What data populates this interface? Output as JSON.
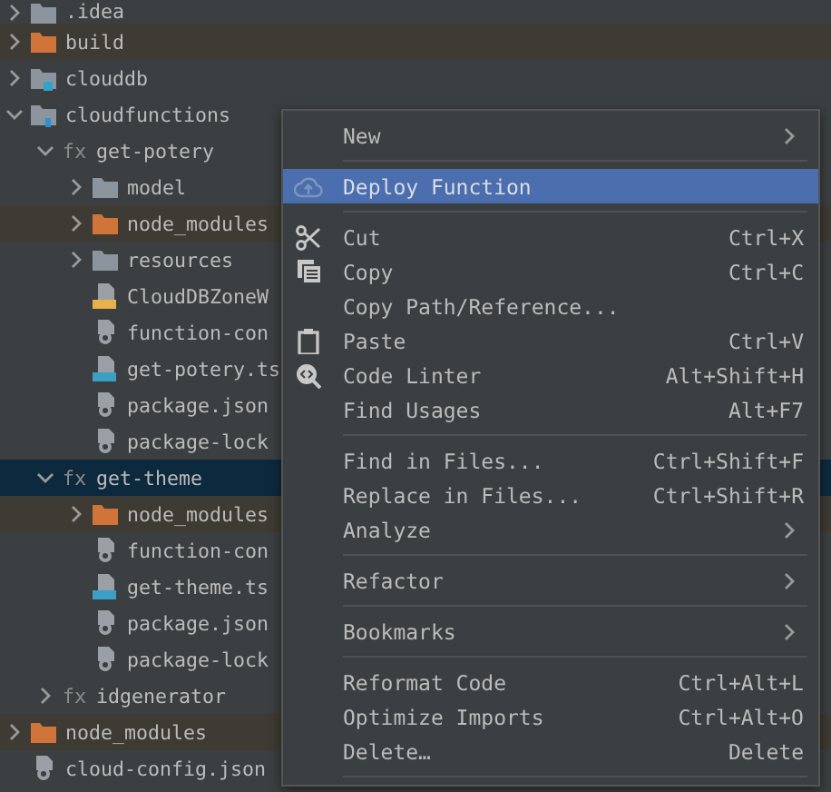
{
  "project_tree": [
    {
      "name": ".idea",
      "kind": "folder",
      "expanded": false,
      "excluded": false,
      "selected": false
    },
    {
      "name": "build",
      "kind": "folder",
      "expanded": false,
      "excluded": true,
      "selected": false
    },
    {
      "name": "clouddb",
      "kind": "db-folder",
      "expanded": false,
      "excluded": false,
      "selected": false
    },
    {
      "name": "cloudfunctions",
      "kind": "functions-folder",
      "expanded": true,
      "excluded": false,
      "selected": false,
      "children": [
        {
          "name": "get-potery",
          "kind": "function",
          "badge": "fx",
          "expanded": true,
          "excluded": false,
          "selected": false,
          "children": [
            {
              "name": "model",
              "kind": "folder",
              "expanded": false,
              "excluded": false,
              "selected": false
            },
            {
              "name": "node_modules",
              "kind": "folder",
              "expanded": false,
              "excluded": true,
              "selected": false
            },
            {
              "name": "resources",
              "kind": "folder",
              "expanded": false,
              "excluded": false,
              "selected": false
            },
            {
              "name": "CloudDBZoneW",
              "kind": "js-file",
              "excluded": false,
              "selected": false
            },
            {
              "name": "function-con",
              "kind": "config-file",
              "excluded": false,
              "selected": false
            },
            {
              "name": "get-potery.ts",
              "kind": "ts-file",
              "excluded": false,
              "selected": false
            },
            {
              "name": "package.json",
              "kind": "config-file",
              "excluded": false,
              "selected": false
            },
            {
              "name": "package-lock",
              "kind": "config-file",
              "excluded": false,
              "selected": false
            }
          ]
        },
        {
          "name": "get-theme",
          "kind": "function",
          "badge": "fx",
          "expanded": true,
          "excluded": false,
          "selected": true,
          "children": [
            {
              "name": "node_modules",
              "kind": "folder",
              "expanded": false,
              "excluded": true,
              "selected": false
            },
            {
              "name": "function-con",
              "kind": "config-file",
              "excluded": false,
              "selected": false
            },
            {
              "name": "get-theme.ts",
              "kind": "ts-file",
              "excluded": false,
              "selected": false
            },
            {
              "name": "package.json",
              "kind": "config-file",
              "excluded": false,
              "selected": false
            },
            {
              "name": "package-lock",
              "kind": "config-file",
              "excluded": false,
              "selected": false
            }
          ]
        },
        {
          "name": "idgenerator",
          "kind": "function",
          "badge": "fx",
          "expanded": false,
          "excluded": false,
          "selected": false
        }
      ]
    },
    {
      "name": "node_modules",
      "kind": "folder",
      "expanded": false,
      "excluded": true,
      "selected": false
    },
    {
      "name": "cloud-config.json",
      "kind": "config-file",
      "excluded": false,
      "selected": false
    }
  ],
  "context_menu": [
    {
      "kind": "item",
      "label": "New",
      "submenu": true,
      "selected": false
    },
    {
      "kind": "separator"
    },
    {
      "kind": "item",
      "label": "Deploy Function",
      "selected": true
    },
    {
      "kind": "separator"
    },
    {
      "kind": "item",
      "label": "Cut",
      "shortcut": "Ctrl+X",
      "selected": false
    },
    {
      "kind": "item",
      "label": "Copy",
      "shortcut": "Ctrl+C",
      "selected": false
    },
    {
      "kind": "item",
      "label": "Copy Path/Reference...",
      "selected": false
    },
    {
      "kind": "item",
      "label": "Paste",
      "shortcut": "Ctrl+V",
      "selected": false
    },
    {
      "kind": "item",
      "label": "Code Linter",
      "shortcut": "Alt+Shift+H",
      "selected": false
    },
    {
      "kind": "item",
      "label": "Find Usages",
      "shortcut": "Alt+F7",
      "selected": false
    },
    {
      "kind": "separator"
    },
    {
      "kind": "item",
      "label": "Find in Files...",
      "shortcut": "Ctrl+Shift+F",
      "selected": false
    },
    {
      "kind": "item",
      "label": "Replace in Files...",
      "shortcut": "Ctrl+Shift+R",
      "selected": false
    },
    {
      "kind": "item",
      "label": "Analyze",
      "submenu": true,
      "selected": false
    },
    {
      "kind": "separator"
    },
    {
      "kind": "item",
      "label": "Refactor",
      "submenu": true,
      "selected": false
    },
    {
      "kind": "separator"
    },
    {
      "kind": "item",
      "label": "Bookmarks",
      "submenu": true,
      "selected": false
    },
    {
      "kind": "separator"
    },
    {
      "kind": "item",
      "label": "Reformat Code",
      "shortcut": "Ctrl+Alt+L",
      "selected": false
    },
    {
      "kind": "item",
      "label": "Optimize Imports",
      "shortcut": "Ctrl+Alt+O",
      "selected": false
    },
    {
      "kind": "item",
      "label": "Delete…",
      "shortcut": "Delete",
      "selected": false
    },
    {
      "kind": "separator"
    }
  ]
}
